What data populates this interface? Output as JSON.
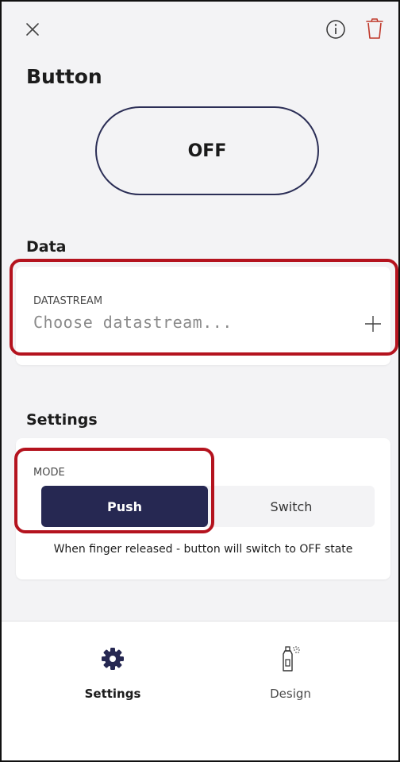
{
  "colors": {
    "accent": "#262852",
    "danger": "#c0392b",
    "highlight": "#b4131e"
  },
  "header": {
    "close_icon": "close-icon",
    "info_icon": "info-icon",
    "trash_icon": "trash-icon"
  },
  "widget": {
    "title": "Button",
    "preview_label": "OFF"
  },
  "data_section": {
    "title": "Data",
    "datastream_label": "DATASTREAM",
    "datastream_placeholder": "Choose datastream...",
    "add_icon": "plus-icon"
  },
  "settings_section": {
    "title": "Settings",
    "mode_label": "MODE",
    "mode_options": [
      "Push",
      "Switch"
    ],
    "selected_mode": "Push",
    "mode_hint": "When finger released - button will switch to OFF state"
  },
  "bottom_nav": {
    "items": [
      {
        "label": "Settings",
        "icon": "gear-icon",
        "active": true
      },
      {
        "label": "Design",
        "icon": "spray-can-icon",
        "active": false
      }
    ]
  }
}
